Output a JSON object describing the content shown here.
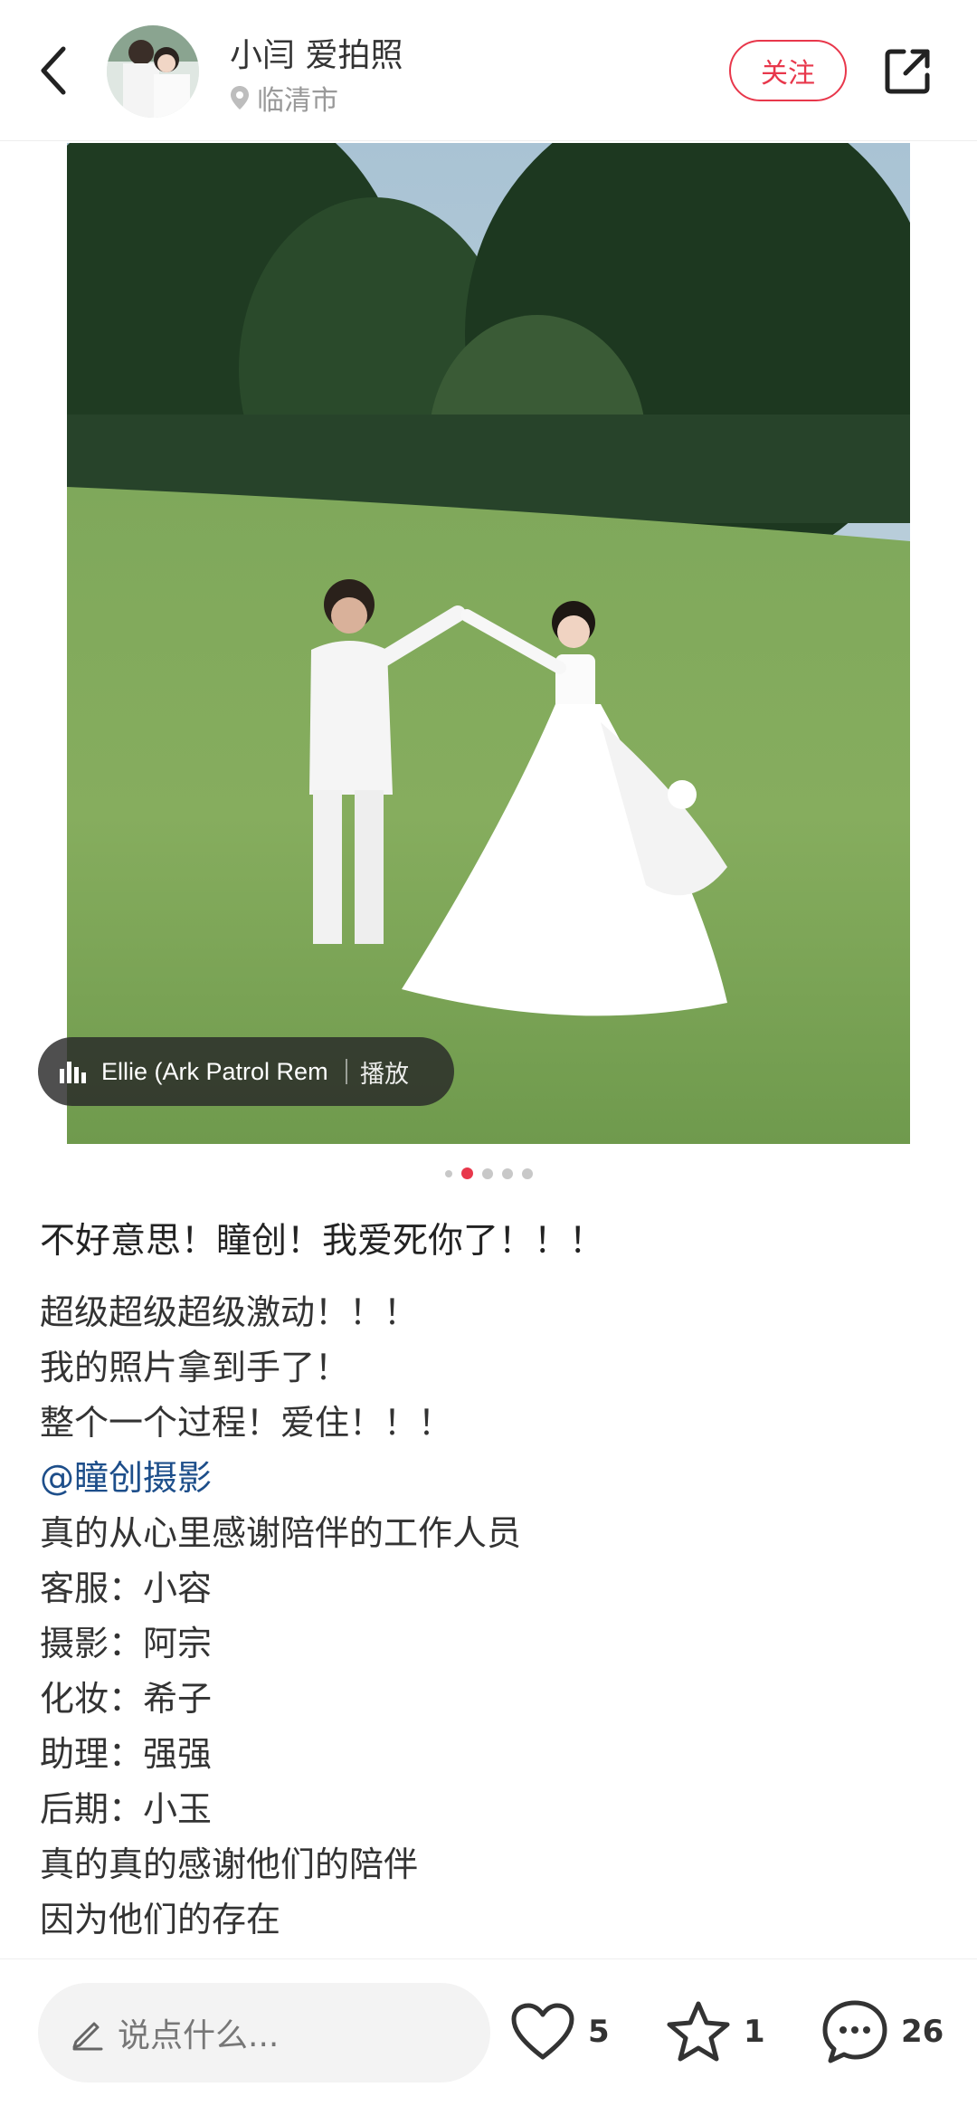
{
  "header": {
    "author_name": "小闫 爱拍照",
    "location": "临清市",
    "follow_label": "关注"
  },
  "media": {
    "music_title": "Ellie (Ark Patrol Rem",
    "music_play_label": "播放",
    "page_count": 5,
    "current_page": 2
  },
  "post": {
    "title": "不好意思！瞳创！我爱死你了！！！",
    "lines": [
      "超级超级超级激动！！！",
      "我的照片拿到手了！",
      "整个一个过程！爱住！！！",
      "@瞳创摄影",
      "真的从心里感谢陪伴的工作人员",
      "客服：小容",
      "摄影：阿宗",
      "化妆：希子",
      "助理：强强",
      "后期：小玉",
      "真的真的感谢他们的陪伴",
      "因为他们的存在"
    ]
  },
  "bottom_bar": {
    "comment_placeholder": "说点什么...",
    "like_count": "5",
    "collect_count": "1",
    "comment_count": "26"
  },
  "colors": {
    "accent": "#e8374b",
    "mention": "#1d4e8a"
  },
  "icons": {
    "back": "back-arrow-icon",
    "location": "location-pin-icon",
    "share": "share-icon",
    "music": "audio-bars-icon",
    "edit": "pencil-icon",
    "like": "heart-icon",
    "collect": "star-icon",
    "comment": "comment-bubble-icon"
  }
}
